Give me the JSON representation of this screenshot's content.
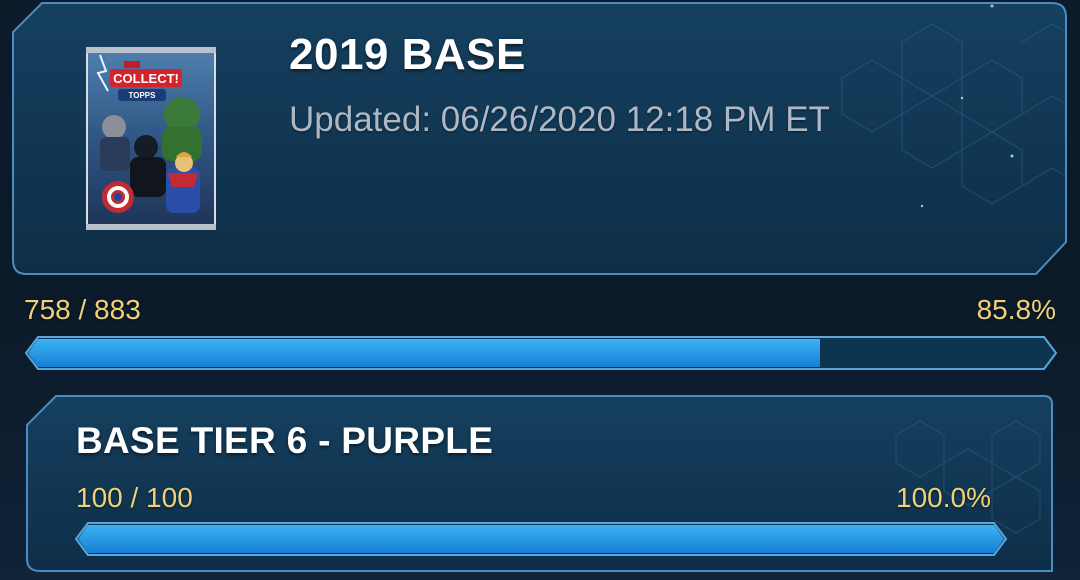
{
  "collection": {
    "title": "2019 BASE",
    "updated": "Updated: 06/26/2020 12:18 PM ET",
    "progress_text": "758 / 883",
    "percent_text": "85.8%",
    "progress_fraction": 0.858,
    "pack_image": {
      "brand": "MARVEL",
      "name": "COLLECT!",
      "publisher": "TOPPS"
    }
  },
  "tier": {
    "title": "BASE TIER 6 - PURPLE",
    "progress_text": "100 / 100",
    "percent_text": "100.0%",
    "progress_fraction": 1.0
  },
  "colors": {
    "accent_bar": "#1e9ae8",
    "frame_border": "#4f8fc4",
    "gold_text": "#f0d17a"
  }
}
